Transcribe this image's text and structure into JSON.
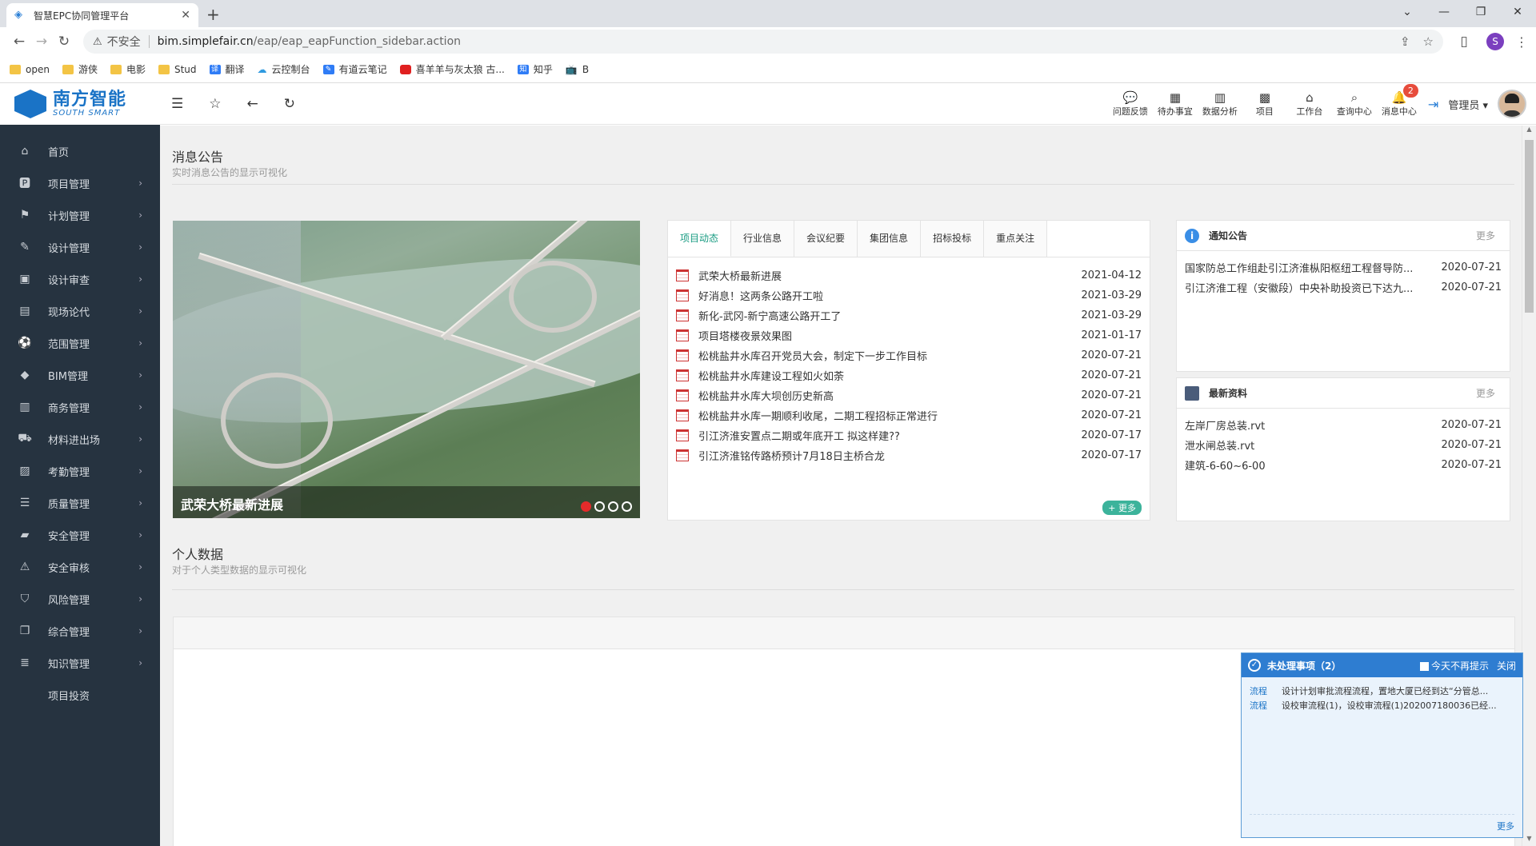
{
  "browser": {
    "tab_title": "智慧EPC协同管理平台",
    "tab_close": "✕",
    "new_tab": "+",
    "insecure_label": "不安全",
    "url_host": "bim.simplefair.cn",
    "url_path": "/eap/eap_eapFunction_sidebar.action",
    "profile_initial": "S",
    "bookmarks": [
      "open",
      "游侠",
      "电影",
      "Stud",
      "翻译",
      "云控制台",
      "有道云笔记",
      "喜羊羊与灰太狼 古...",
      "知乎",
      "B"
    ]
  },
  "app": {
    "logo_cn": "南方智能",
    "logo_en": "SOUTH SMART",
    "header_items": [
      {
        "label": "问题反馈",
        "icon": "comments-icon"
      },
      {
        "label": "待办事宜",
        "icon": "calendar-icon"
      },
      {
        "label": "数据分析",
        "icon": "bar-chart-icon"
      },
      {
        "label": "项目",
        "icon": "grid-icon"
      },
      {
        "label": "工作台",
        "icon": "home-icon"
      },
      {
        "label": "查询中心",
        "icon": "search-icon"
      },
      {
        "label": "消息中心",
        "icon": "bell-icon"
      }
    ],
    "message_badge": "2",
    "user_label": "管理员 ▾"
  },
  "sidebar": {
    "items": [
      {
        "label": "首页",
        "icon": "home-icon",
        "arrow": false
      },
      {
        "label": "项目管理",
        "icon": "parking-icon",
        "arrow": true
      },
      {
        "label": "计划管理",
        "icon": "flag-icon",
        "arrow": true
      },
      {
        "label": "设计管理",
        "icon": "pencil-icon",
        "arrow": true
      },
      {
        "label": "设计审查",
        "icon": "briefcase-icon",
        "arrow": true
      },
      {
        "label": "现场论代",
        "icon": "id-card-icon",
        "arrow": true
      },
      {
        "label": "范围管理",
        "icon": "soccer-ball-icon",
        "arrow": true
      },
      {
        "label": "BIM管理",
        "icon": "cube-icon",
        "arrow": true
      },
      {
        "label": "商务管理",
        "icon": "building-icon",
        "arrow": true
      },
      {
        "label": "材料进出场",
        "icon": "truck-icon",
        "arrow": true
      },
      {
        "label": "考勤管理",
        "icon": "badge-icon",
        "arrow": true
      },
      {
        "label": "质量管理",
        "icon": "list-icon",
        "arrow": true
      },
      {
        "label": "安全管理",
        "icon": "book-icon",
        "arrow": true
      },
      {
        "label": "安全审核",
        "icon": "warning-icon",
        "arrow": true
      },
      {
        "label": "风险管理",
        "icon": "shield-icon",
        "arrow": true
      },
      {
        "label": "综合管理",
        "icon": "files-icon",
        "arrow": true
      },
      {
        "label": "知识管理",
        "icon": "list-ol-icon",
        "arrow": true
      },
      {
        "label": "项目投资",
        "icon": "",
        "arrow": false
      }
    ]
  },
  "notices": {
    "title": "消息公告",
    "subtitle": "实时消息公告的显示可视化",
    "carousel_caption": "武荣大桥最新进展",
    "carousel_active_index": 1,
    "tabs": [
      "项目动态",
      "行业信息",
      "会议纪要",
      "集团信息",
      "招标投标",
      "重点关注"
    ],
    "news": [
      {
        "title": "武荣大桥最新进展",
        "date": "2021-04-12"
      },
      {
        "title": "好消息！这两条公路开工啦",
        "date": "2021-03-29"
      },
      {
        "title": "新化-武冈-新宁高速公路开工了",
        "date": "2021-03-29"
      },
      {
        "title": "项目塔楼夜景效果图",
        "date": "2021-01-17"
      },
      {
        "title": "松桃盐井水库召开党员大会，制定下一步工作目标",
        "date": "2020-07-21"
      },
      {
        "title": "松桃盐井水库建设工程如火如荼",
        "date": "2020-07-21"
      },
      {
        "title": "松桃盐井水库大坝创历史新高",
        "date": "2020-07-21"
      },
      {
        "title": "松桃盐井水库一期顺利收尾，二期工程招标正常进行",
        "date": "2020-07-21"
      },
      {
        "title": "引江济淮安置点二期或年底开工 拟这样建??",
        "date": "2020-07-17"
      },
      {
        "title": "引江济淮铭传路桥预计7月18日主桥合龙",
        "date": "2020-07-17"
      }
    ],
    "more_label": "+ 更多"
  },
  "notice_box": {
    "title": "通知公告",
    "more": "更多",
    "rows": [
      {
        "title": "国家防总工作组赴引江济淮枞阳枢纽工程督导防...",
        "date": "2020-07-21"
      },
      {
        "title": "引江济淮工程（安徽段）中央补助投资已下达九...",
        "date": "2020-07-21"
      }
    ]
  },
  "latest_box": {
    "title": "最新资料",
    "more": "更多",
    "rows": [
      {
        "title": "左岸厂房总装.rvt",
        "date": "2020-07-21"
      },
      {
        "title": "泄水闸总装.rvt",
        "date": "2020-07-21"
      },
      {
        "title": "建筑-6-60~6-00",
        "date": "2020-07-21"
      }
    ]
  },
  "personal": {
    "title": "个人数据",
    "subtitle": "对于个人类型数据的显示可视化"
  },
  "popup": {
    "title": "未处理事项（2）",
    "option": "今天不再提示",
    "close": "关闭",
    "rows": [
      {
        "type": "流程",
        "text": "设计计划审批流程流程，置地大厦已经到达“分管总..."
      },
      {
        "type": "流程",
        "text": "设校审流程(1)，设校审流程(1)202007180036已经..."
      }
    ],
    "more": "更多"
  }
}
